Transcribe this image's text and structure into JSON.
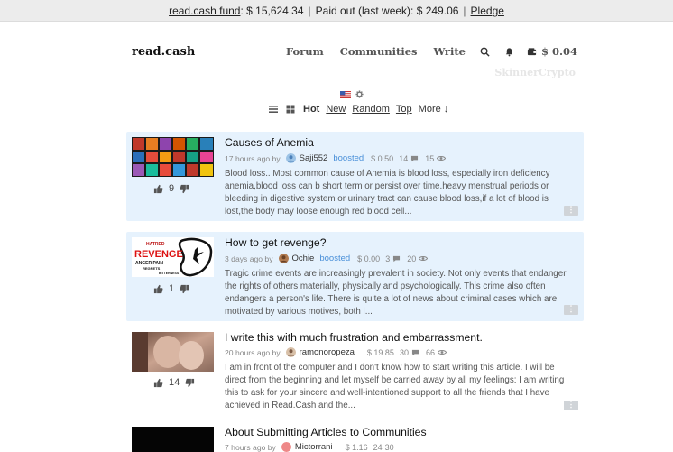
{
  "topbar": {
    "fund_label": "read.cash fund",
    "fund_value": ": $ 15,624.34",
    "sep": "|",
    "paid_label": "Paid out (last week): $ 249.06",
    "pledge_label": "Pledge"
  },
  "header": {
    "logo": "read.cash",
    "nav": {
      "forum": "Forum",
      "communities": "Communities",
      "write": "Write"
    },
    "balance": "$ 0.04",
    "username": "SkinnerCrypto"
  },
  "sort": {
    "hot": "Hot",
    "new": "New",
    "random": "Random",
    "top": "Top",
    "more": "More ↓"
  },
  "articles": [
    {
      "title": "Causes of Anemia",
      "time": "17 hours ago by",
      "author": "Saji552",
      "boosted": "boosted",
      "amount": "$ 0.50",
      "comments": "14",
      "views": "15",
      "votes": "9",
      "excerpt": "Blood loss.. Most common cause of Anemia is blood loss, especially iron deficiency anemia,blood loss can b short term or persist over time.heavy menstrual periods or bleeding in digestive system or urinary tract can cause blood loss,if a lot of blood is lost,the body may loose enough red blood cell..."
    },
    {
      "title": "How to get revenge?",
      "time": "3 days ago by",
      "author": "Ochie",
      "boosted": "boosted",
      "amount": "$ 0.00",
      "comments": "3",
      "views": "20",
      "votes": "1",
      "thumb_text": [
        "HATRED",
        "REVENGE",
        "ANGER  PAIN",
        "REGRETS",
        "BITTERNESS"
      ],
      "excerpt": "Tragic crime events are increasingly prevalent in society. Not only events that endanger the rights of others materially, physically and psychologically. This crime also often endangers a person's life. There is quite a lot of news about criminal cases which are motivated by various motives, both l..."
    },
    {
      "title": "I write this with much frustration and embarrassment.",
      "time": "20 hours ago by",
      "author": "ramonoropeza",
      "amount": "$ 19.85",
      "comments": "30",
      "views": "66",
      "votes": "14",
      "excerpt": "I am in front of the computer and I don't know how to start writing this article. I will be direct from the beginning and let myself be carried away by all my feelings: I am writing this to ask for your sincere and well-intentioned support to all the friends that I have achieved in Read.Cash and the..."
    },
    {
      "title": "About Submitting Articles to Communities",
      "time": "7 hours ago by",
      "author": "Mictorrani",
      "amount": "$ 1.16",
      "comments": "24",
      "views": "30"
    }
  ]
}
